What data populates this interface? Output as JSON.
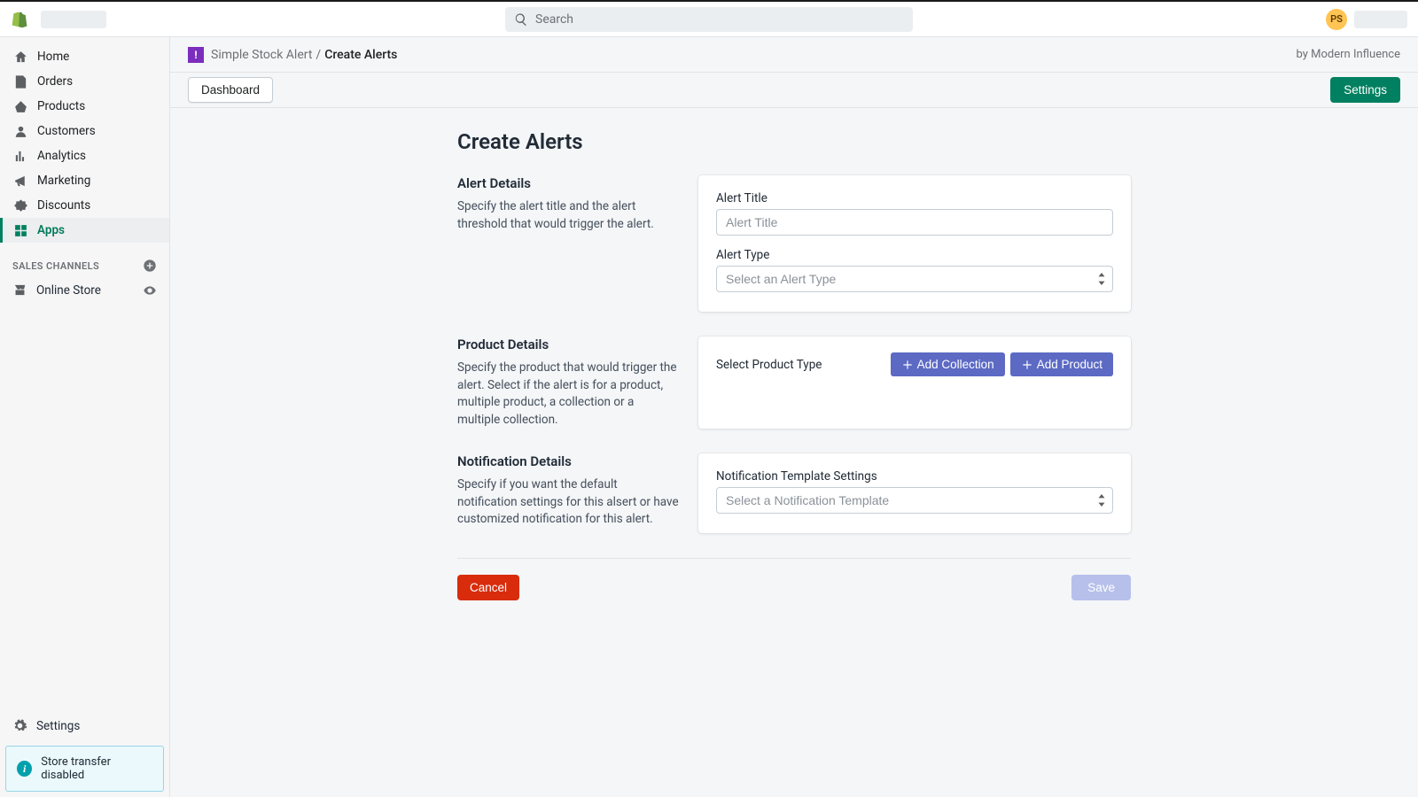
{
  "topbar": {
    "search_placeholder": "Search",
    "avatar_initials": "PS"
  },
  "sidebar": {
    "items": [
      {
        "label": "Home"
      },
      {
        "label": "Orders"
      },
      {
        "label": "Products"
      },
      {
        "label": "Customers"
      },
      {
        "label": "Analytics"
      },
      {
        "label": "Marketing"
      },
      {
        "label": "Discounts"
      },
      {
        "label": "Apps"
      }
    ],
    "section_label": "SALES CHANNELS",
    "channels": [
      {
        "label": "Online Store"
      }
    ],
    "settings_label": "Settings",
    "transfer_banner": "Store transfer disabled"
  },
  "breadcrumb": {
    "root": "Simple Stock Alert",
    "leaf": "Create Alerts",
    "by": "by Modern Influence",
    "app_icon_char": "!"
  },
  "toolbar": {
    "dashboard_label": "Dashboard",
    "settings_label": "Settings"
  },
  "page": {
    "title": "Create Alerts",
    "sections": {
      "alert": {
        "heading": "Alert Details",
        "description": "Specify the alert title and the alert threshold that would trigger the alert.",
        "title_label": "Alert Title",
        "title_placeholder": "Alert Title",
        "type_label": "Alert Type",
        "type_placeholder": "Select an Alert Type"
      },
      "product": {
        "heading": "Product Details",
        "description": "Specify the product that would trigger the alert. Select if the alert is for a product, multiple product, a collection or a multiple collection.",
        "select_label": "Select Product Type",
        "add_collection_label": "Add Collection",
        "add_product_label": "Add Product"
      },
      "notification": {
        "heading": "Notification Details",
        "description": "Specify if you want the default notification settings for this alsert or have customized notification for this alert.",
        "template_label": "Notification Template Settings",
        "template_placeholder": "Select a Notification Template"
      }
    },
    "footer": {
      "cancel_label": "Cancel",
      "save_label": "Save"
    }
  }
}
